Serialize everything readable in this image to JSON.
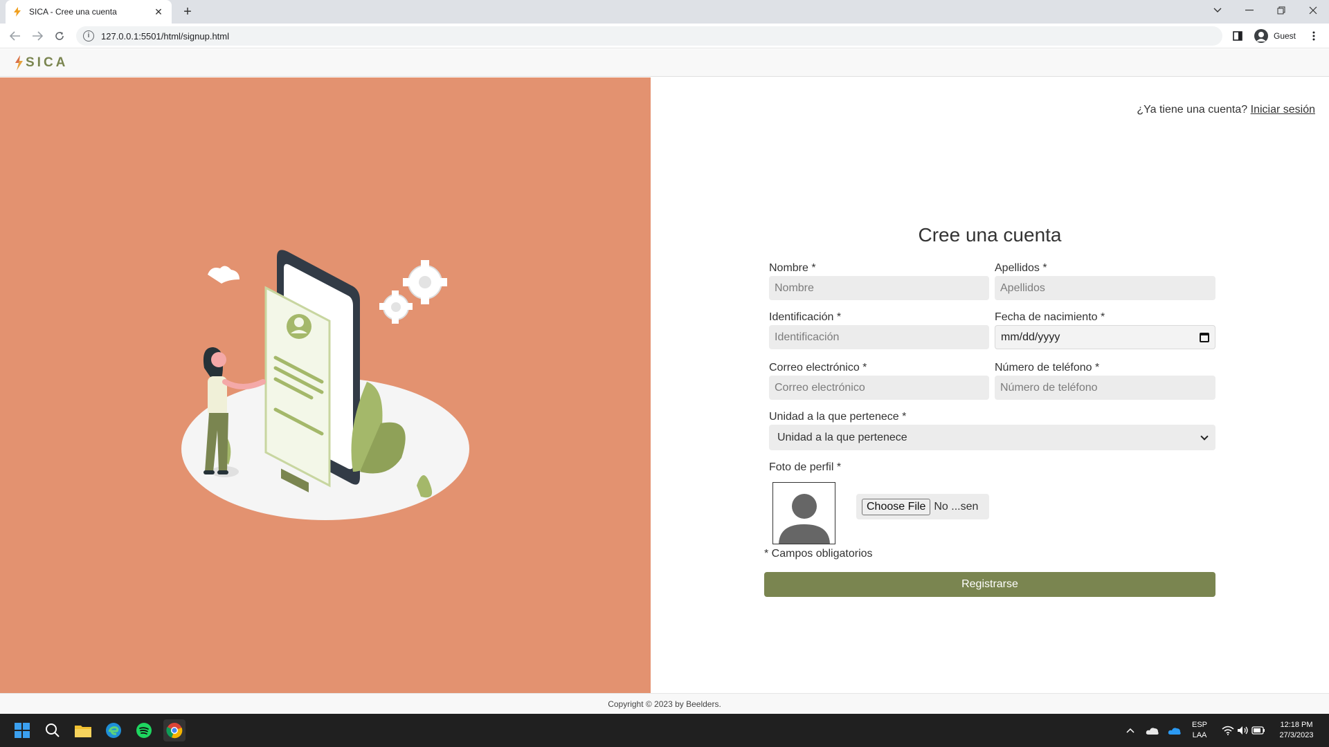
{
  "browser": {
    "tab_title": "SICA - Cree una cuenta",
    "tab_close": "✕",
    "new_tab": "+",
    "url": "127.0.0.1:5501/html/signup.html",
    "profile_label": "Guest"
  },
  "site": {
    "logo_text": "SICA",
    "brand_color": "#7a8550",
    "panel_color": "#e39270"
  },
  "header": {
    "login_prompt": "¿Ya tiene una cuenta?",
    "login_link": "Iniciar sesión"
  },
  "form": {
    "title": "Cree una cuenta",
    "nombre": {
      "label": "Nombre *",
      "placeholder": "Nombre"
    },
    "apellidos": {
      "label": "Apellidos *",
      "placeholder": "Apellidos"
    },
    "identificacion": {
      "label": "Identificación *",
      "placeholder": "Identificación"
    },
    "fecha": {
      "label": "Fecha de nacimiento *",
      "value": "mm/dd/yyyy"
    },
    "correo": {
      "label": "Correo electrónico *",
      "placeholder": "Correo electrónico"
    },
    "telefono": {
      "label": "Número de teléfono *",
      "placeholder": "Número de teléfono"
    },
    "unidad": {
      "label": "Unidad a la que pertenece *",
      "selected": "Unidad a la que pertenece"
    },
    "foto": {
      "label": "Foto de perfil *",
      "button": "Choose File",
      "status": "No ...sen"
    },
    "required_note": "* Campos obligatorios",
    "submit": "Registrarse"
  },
  "footer": {
    "text": "Copyright © 2023 by Beelders."
  },
  "taskbar": {
    "lang_top": "ESP",
    "lang_bottom": "LAA",
    "time": "12:18 PM",
    "date": "27/3/2023"
  }
}
